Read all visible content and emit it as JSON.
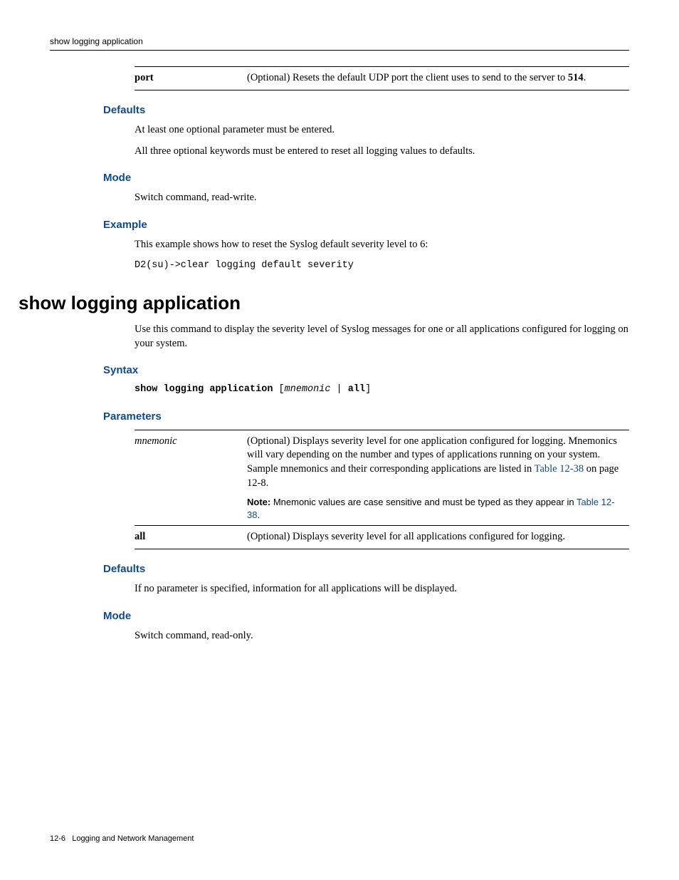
{
  "header": {
    "title": "show logging application"
  },
  "paramTable1": {
    "key": "port",
    "desc_pre": "(Optional) Resets the default UDP port the client uses to send to the server to ",
    "desc_bold": "514",
    "desc_post": "."
  },
  "defaults1": {
    "heading": "Defaults",
    "line1": "At least one optional parameter must be entered.",
    "line2": "All three optional keywords must be entered to reset all logging values to defaults."
  },
  "mode1": {
    "heading": "Mode",
    "text": "Switch command, read-write."
  },
  "example": {
    "heading": "Example",
    "text": "This example shows how to reset the Syslog default severity level to 6:",
    "code": "D2(su)->clear logging default severity"
  },
  "cmdTitle": "show logging application",
  "cmdIntro": "Use this command to display the severity level of Syslog messages for one or all applications configured for logging on your system.",
  "syntax": {
    "heading": "Syntax",
    "bold1": "show logging application",
    "plain1": " [",
    "italic1": "mnemonic",
    "plain2": " | ",
    "bold2": "all",
    "plain3": "]"
  },
  "parameters": {
    "heading": "Parameters",
    "row1": {
      "key": "mnemonic",
      "desc_pre": "(Optional) Displays severity level for one application configured for logging. Mnemonics will vary depending on the number and types of applications running on your system. Sample mnemonics and their corresponding applications are listed in ",
      "link": "Table 12-38",
      "desc_post": " on page 12-8."
    },
    "row1note": {
      "bold": "Note:",
      "text": " Mnemonic values are case sensitive and must be typed as they appear in ",
      "link": "Table 12-38",
      "post": "."
    },
    "row2": {
      "key": "all",
      "desc": "(Optional) Displays severity level for all applications configured for logging."
    }
  },
  "defaults2": {
    "heading": "Defaults",
    "text": "If no parameter is specified, information for all applications will be displayed."
  },
  "mode2": {
    "heading": "Mode",
    "text": "Switch command, read-only."
  },
  "footer": {
    "page": "12-6",
    "chapter": "Logging and Network Management"
  }
}
